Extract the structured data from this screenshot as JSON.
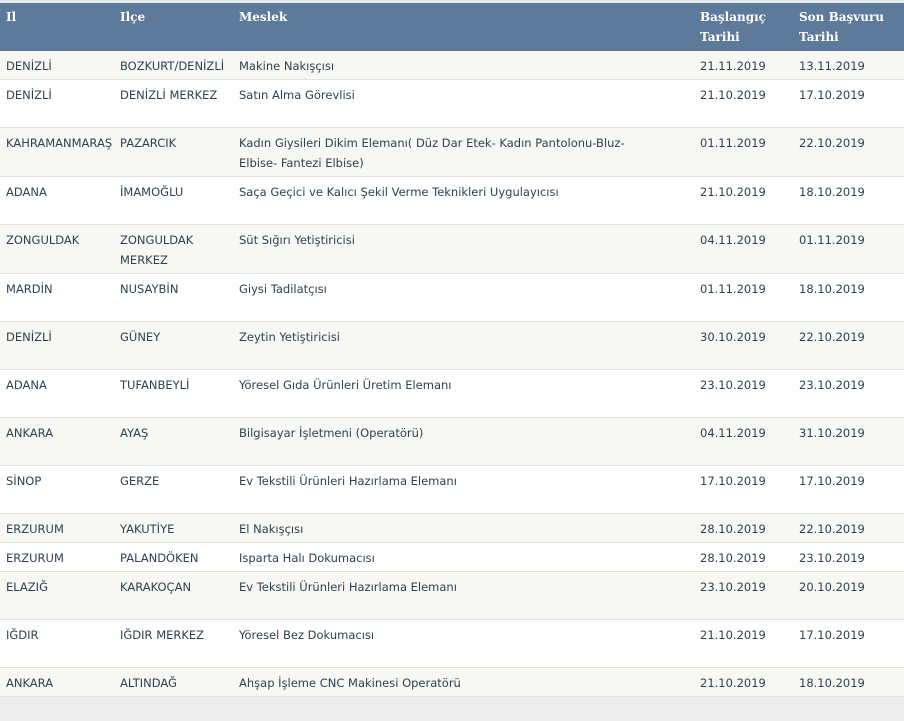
{
  "headers": {
    "il": "Il",
    "ilce": "Ilçe",
    "meslek": "Meslek",
    "baslangic": "Başlangıç Tarihi",
    "son_basvuru": "Son Başvuru Tarihi"
  },
  "rows": [
    {
      "il": "DENİZLİ",
      "ilce": "BOZKURT/DENİZLİ",
      "meslek": "Makine Nakışçısı",
      "baslangic": "21.11.2019",
      "son": "13.11.2019"
    },
    {
      "il": "DENİZLİ",
      "ilce": "DENİZLİ MERKEZ",
      "meslek": "Satın Alma Görevlisi",
      "baslangic": "21.10.2019",
      "son": "17.10.2019"
    },
    {
      "il": "KAHRAMANMARAŞ",
      "ilce": "PAZARCIK",
      "meslek": "Kadın Giysileri Dikim Elemanı( Düz Dar Etek- Kadın Pantolonu-Bluz- Elbise- Fantezi Elbise)",
      "baslangic": "01.11.2019",
      "son": "22.10.2019"
    },
    {
      "il": "ADANA",
      "ilce": "İMAMOĞLU",
      "meslek": "Saça Geçici ve Kalıcı Şekil Verme Teknikleri Uygulayıcısı",
      "baslangic": "21.10.2019",
      "son": "18.10.2019"
    },
    {
      "il": "ZONGULDAK",
      "ilce": "ZONGULDAK MERKEZ",
      "meslek": "Süt Sığırı Yetiştiricisi",
      "baslangic": "04.11.2019",
      "son": "01.11.2019"
    },
    {
      "il": "MARDİN",
      "ilce": "NUSAYBİN",
      "meslek": "Giysi Tadilatçısı",
      "baslangic": "01.11.2019",
      "son": "18.10.2019"
    },
    {
      "il": "DENİZLİ",
      "ilce": "GÜNEY",
      "meslek": "Zeytin Yetiştiricisi",
      "baslangic": "30.10.2019",
      "son": "22.10.2019"
    },
    {
      "il": "ADANA",
      "ilce": "TUFANBEYLİ",
      "meslek": "Yöresel Gıda Ürünleri Üretim Elemanı",
      "baslangic": "23.10.2019",
      "son": "23.10.2019"
    },
    {
      "il": "ANKARA",
      "ilce": "AYAŞ",
      "meslek": "Bilgisayar İşletmeni (Operatörü)",
      "baslangic": "04.11.2019",
      "son": "31.10.2019"
    },
    {
      "il": "SİNOP",
      "ilce": "GERZE",
      "meslek": "Ev Tekstili Ürünleri Hazırlama Elemanı",
      "baslangic": "17.10.2019",
      "son": "17.10.2019"
    },
    {
      "il": "ERZURUM",
      "ilce": "YAKUTİYE",
      "meslek": "El Nakışçısı",
      "baslangic": "28.10.2019",
      "son": "22.10.2019"
    },
    {
      "il": "ERZURUM",
      "ilce": "PALANDÖKEN",
      "meslek": "Isparta Halı Dokumacısı",
      "baslangic": "28.10.2019",
      "son": "23.10.2019"
    },
    {
      "il": "ELAZIĞ",
      "ilce": "KARAKOÇAN",
      "meslek": "Ev Tekstili Ürünleri Hazırlama Elemanı",
      "baslangic": "23.10.2019",
      "son": "20.10.2019"
    },
    {
      "il": "IĞDIR",
      "ilce": "IĞDIR MERKEZ",
      "meslek": "Yöresel Bez Dokumacısı",
      "baslangic": "21.10.2019",
      "son": "17.10.2019"
    },
    {
      "il": "ANKARA",
      "ilce": "ALTINDAĞ",
      "meslek": "Ahşap İşleme CNC Makinesi Operatörü",
      "baslangic": "21.10.2019",
      "son": "18.10.2019"
    }
  ]
}
